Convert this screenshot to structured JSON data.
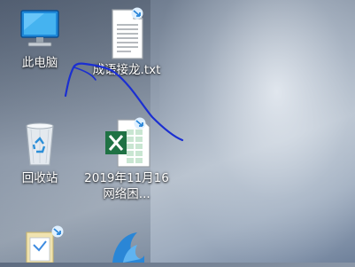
{
  "desktop": {
    "icons": [
      {
        "label": "此电脑",
        "icon": "computer-icon"
      },
      {
        "label": "成语接龙.txt",
        "icon": "text-file-icon"
      },
      {
        "label": "回收站",
        "icon": "recycle-bin-icon"
      },
      {
        "label": "2019年11月16网络困...",
        "icon": "excel-file-icon"
      },
      {
        "label": "",
        "icon": "folder-icon"
      },
      {
        "label": "",
        "icon": "app-icon"
      }
    ],
    "annotation": "blue-ink-scribble"
  },
  "colors": {
    "ink": "#1b2fd1",
    "excel_green": "#1f7244",
    "shortcut_blue": "#2b86d9"
  }
}
